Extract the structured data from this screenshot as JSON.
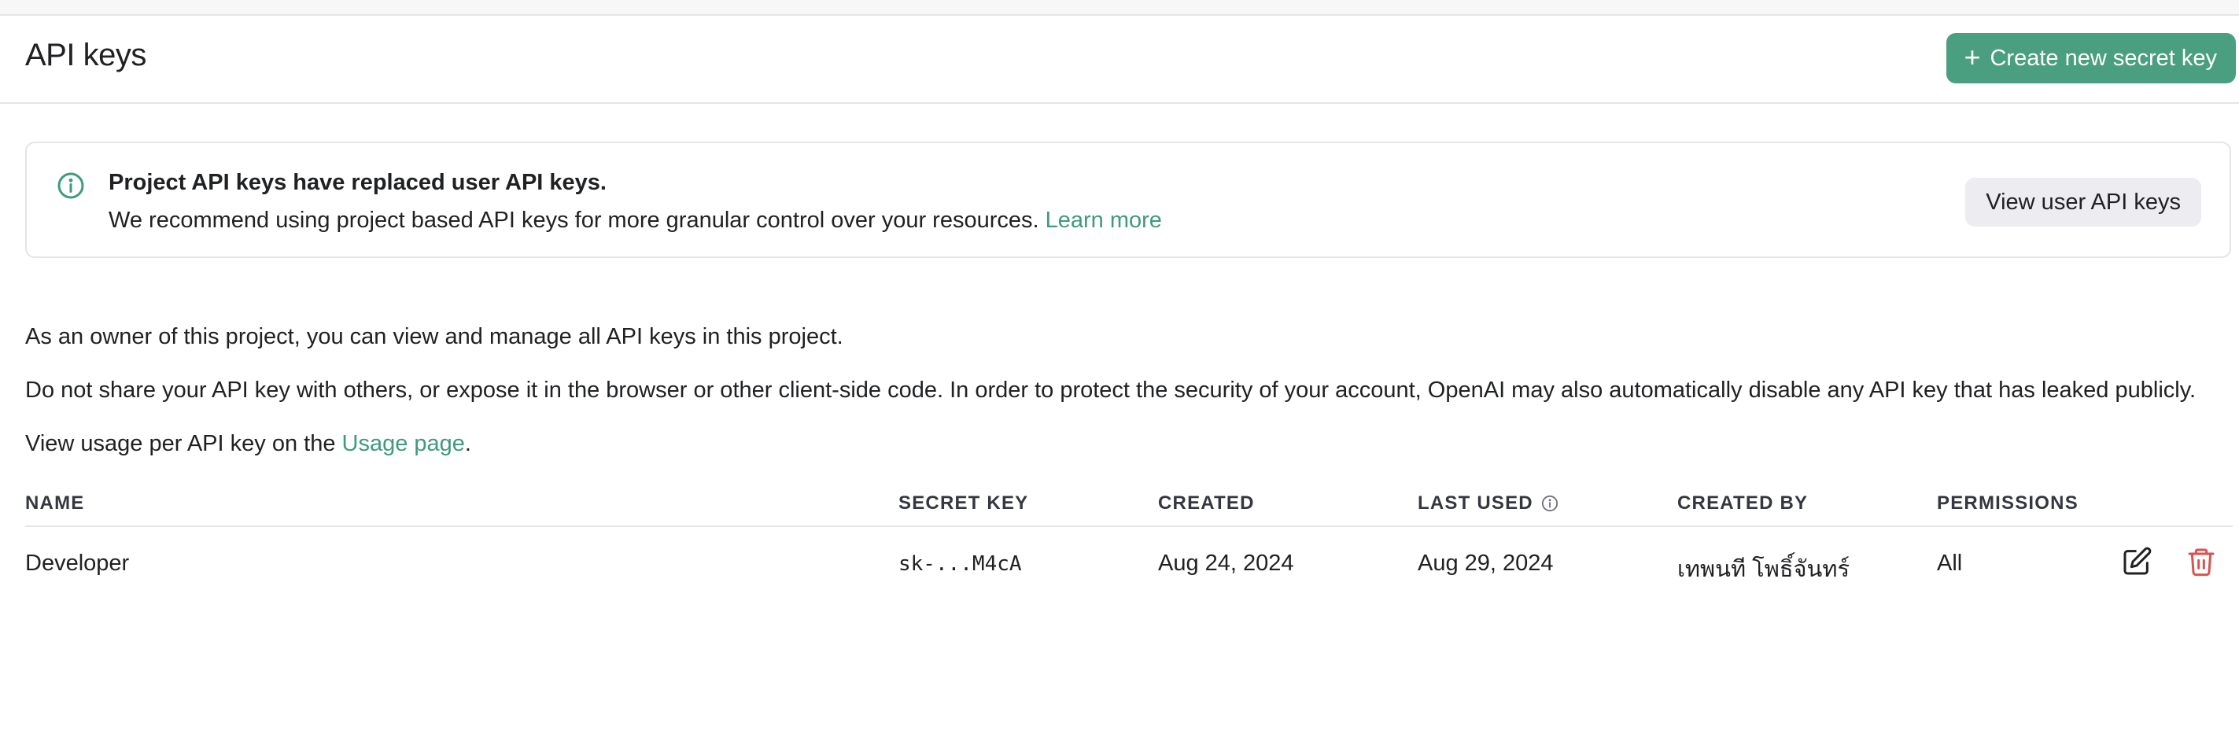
{
  "header": {
    "title": "API keys",
    "create_button_label": "Create new secret key",
    "create_button_icon": "plus-icon"
  },
  "banner": {
    "icon": "info-circle-icon",
    "title": "Project API keys have replaced user API keys.",
    "body": "We recommend using project based API keys for more granular control over your resources.",
    "learn_more_link": "Learn more",
    "view_button_label": "View user API keys"
  },
  "info": {
    "owner_text": "As an owner of this project, you can view and manage all API keys in this project.",
    "security_text": "Do not share your API key with others, or expose it in the browser or other client-side code. In order to protect the security of your account, OpenAI may also automatically disable any API key that has leaked publicly.",
    "usage_prefix": "View usage per API key on the",
    "usage_link": "Usage page",
    "usage_suffix": "."
  },
  "table": {
    "columns": [
      "NAME",
      "SECRET KEY",
      "CREATED",
      "LAST USED",
      "CREATED BY",
      "PERMISSIONS"
    ],
    "last_used_info_icon": "info-icon",
    "rows": [
      {
        "name": "Developer",
        "secret_key": "sk-...M4cA",
        "created": "Aug 24, 2024",
        "last_used": "Aug 29, 2024",
        "created_by": "เทพนที โพธิ์จันทร์",
        "permissions": "All",
        "edit_icon": "edit-icon",
        "delete_icon": "trash-icon"
      }
    ]
  },
  "colors": {
    "accent": "#4a9f80",
    "link": "#3f9b7a",
    "danger": "#d9534f",
    "border": "#e5e5e5"
  }
}
